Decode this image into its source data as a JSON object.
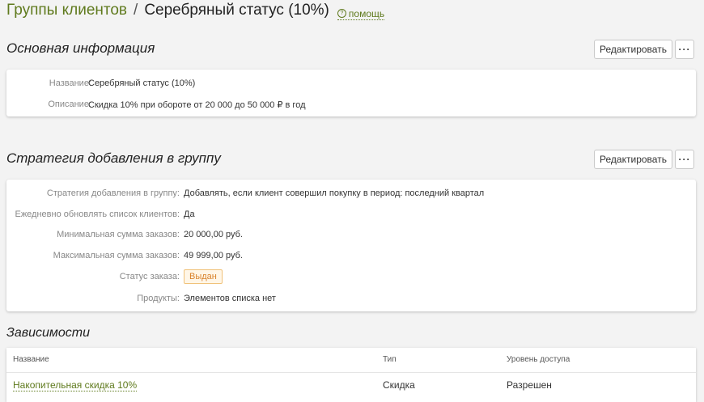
{
  "breadcrumb": {
    "parent": "Группы клиентов",
    "separator": "/",
    "current": "Серебряный статус (10%)",
    "help_icon": "question-circle-icon",
    "help_label": "помощь"
  },
  "basic_info": {
    "title": "Основная информация",
    "edit_label": "Редактировать",
    "more_label": "···",
    "fields": [
      {
        "label": "Название:",
        "value": "Серебряный статус (10%)"
      },
      {
        "label": "Описание:",
        "value": "Скидка 10% при обороте от 20 000 до 50 000 ₽ в год"
      }
    ]
  },
  "strategy": {
    "title": "Стратегия добавления в группу",
    "edit_label": "Редактировать",
    "more_label": "···",
    "fields": [
      {
        "label": "Стратегия добавления в группу:",
        "value": "Добавлять, если клиент совершил покупку в период: последний квартал"
      },
      {
        "label": "Ежедневно обновлять список клиентов:",
        "value": "Да"
      },
      {
        "label": "Минимальная сумма заказов:",
        "value": "20 000,00 руб."
      },
      {
        "label": "Максимальная сумма заказов:",
        "value": "49 999,00 руб."
      },
      {
        "label": "Статус заказа:",
        "value": "Выдан"
      },
      {
        "label": "Продукты:",
        "value": "Элементов списка нет"
      }
    ]
  },
  "dependencies": {
    "title": "Зависимости",
    "columns": [
      "Название",
      "Тип",
      "Уровень доступа"
    ],
    "rows": [
      {
        "name": "Накопительная скидка 10%",
        "type": "Скидка",
        "access": "Разрешен"
      }
    ]
  },
  "colors": {
    "link": "#5f7a1d",
    "badge_text": "#d9822b",
    "badge_bg": "#fff6e7"
  }
}
